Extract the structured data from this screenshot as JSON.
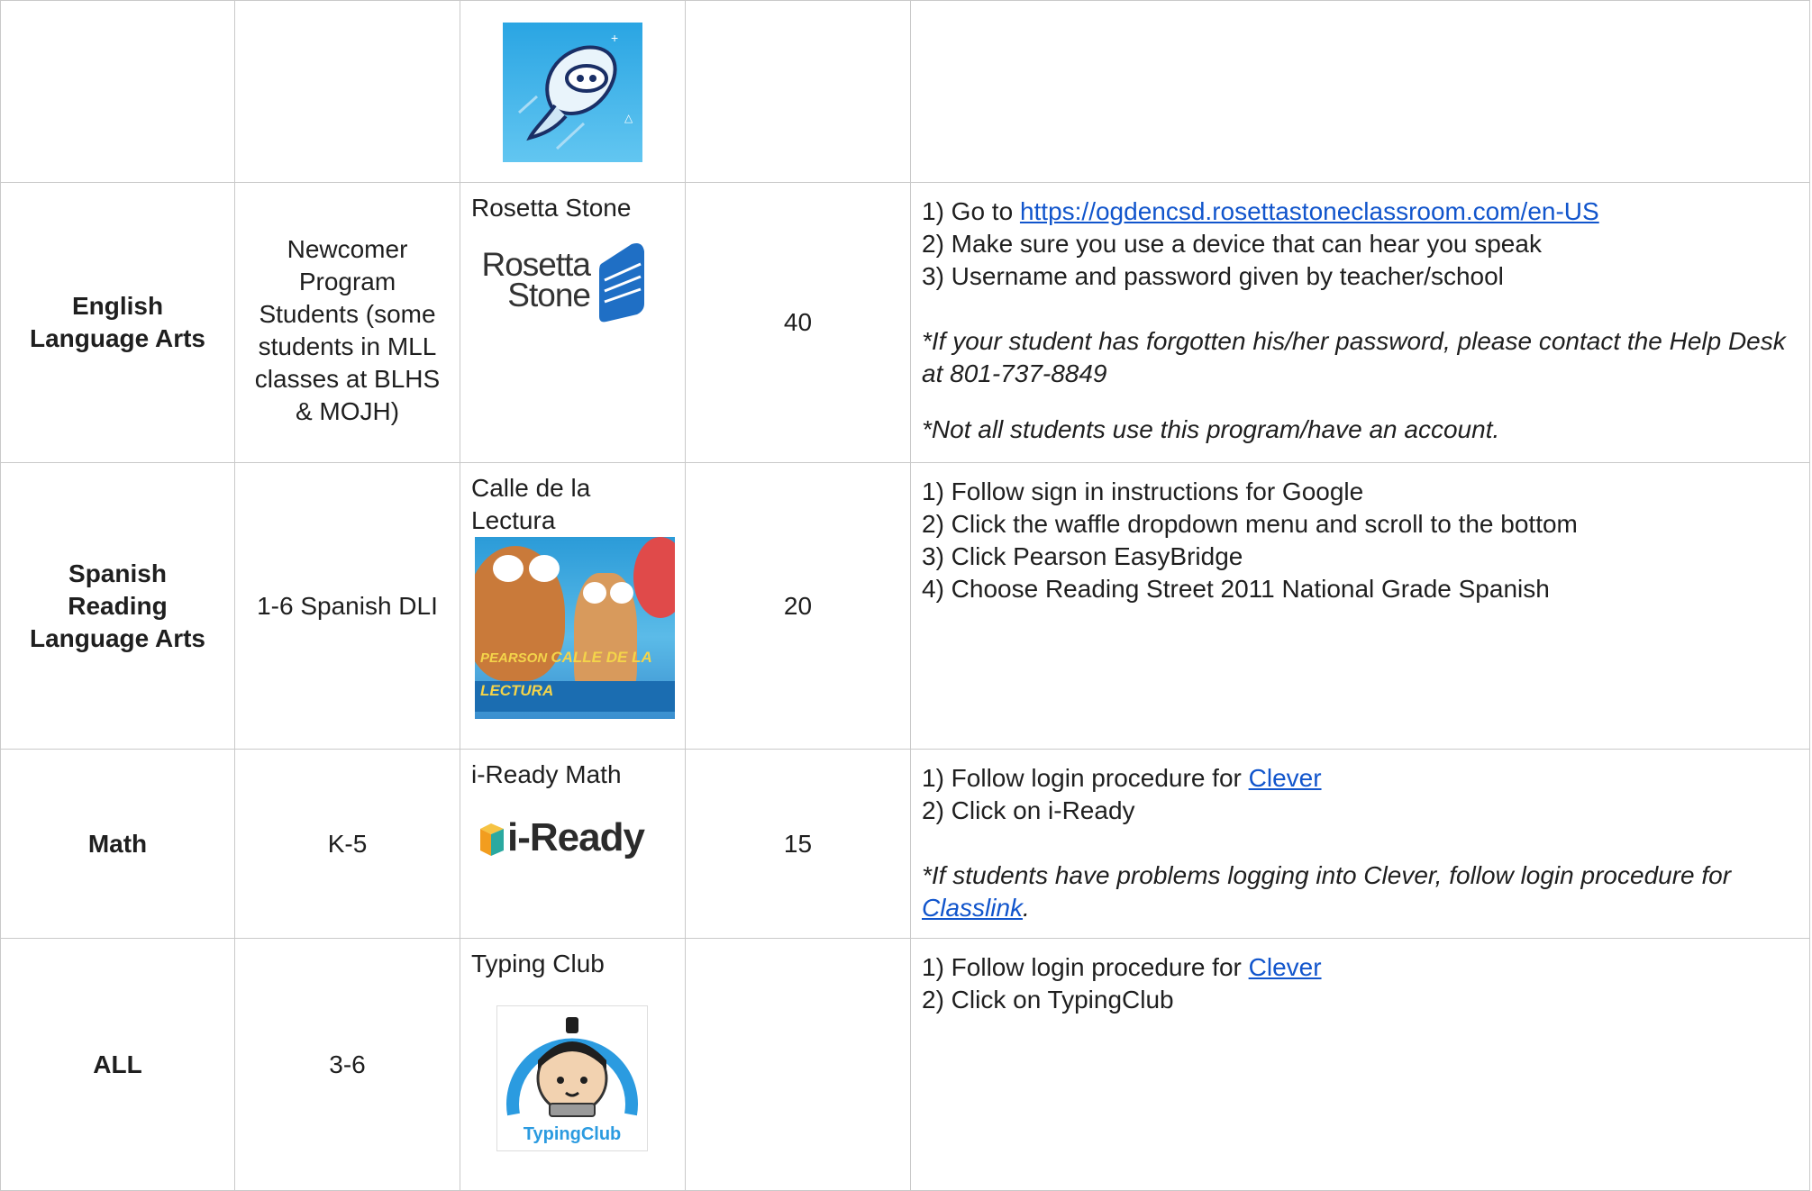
{
  "rows": [
    {
      "subject": "",
      "grades": "",
      "program": "",
      "logo_icon": "rocket-mascot-icon",
      "minutes": "",
      "instructions": []
    },
    {
      "subject_line1": "English",
      "subject_line2": "Language Arts",
      "grades_lines": [
        "Newcomer",
        "Program",
        "Students (some",
        "students in MLL",
        "classes at BLHS",
        "& MOJH)"
      ],
      "program": "Rosetta Stone",
      "logo_text_1": "Rosetta",
      "logo_text_2": "Stone",
      "logo_icon": "rosetta-stone-logo-icon",
      "minutes": "40",
      "step1_prefix": "1) Go to ",
      "step1_link": "https://ogdencsd.rosettastoneclassroom.com/en-US",
      "step2": "2) Make sure you use a device that can hear you speak",
      "step3": "3) Username and password given by teacher/school",
      "note1": "*If your student has forgotten his/her password, please contact the Help Desk at 801-737-8849",
      "note2": "*Not all students use this program/have an account."
    },
    {
      "subject_lines": [
        "Spanish",
        "Reading",
        "Language Arts"
      ],
      "grades": "1-6 Spanish DLI",
      "program_lines": [
        "Calle de la",
        "Lectura"
      ],
      "logo_text_1": "PEARSON",
      "logo_text_2": "CALLE DE LA LECTURA",
      "logo_icon": "calle-de-la-lectura-image-icon",
      "minutes": "20",
      "steps": [
        "1) Follow sign in instructions for Google",
        "2) Click the waffle dropdown menu and scroll to the bottom",
        "3) Click Pearson EasyBridge",
        "4) Choose Reading Street 2011 National Grade Spanish"
      ]
    },
    {
      "subject": "Math",
      "grades": "K-5",
      "program": "i-Ready Math",
      "logo_text": "i-Ready",
      "logo_icon": "i-ready-logo-icon",
      "minutes": "15",
      "step1_prefix": "1) Follow login procedure for ",
      "step1_link": "Clever",
      "step2": "2) Click on i-Ready",
      "note_prefix": "*If students have problems logging into Clever, follow login procedure for ",
      "note_link": "Classlink",
      "note_suffix": "."
    },
    {
      "subject": "ALL",
      "grades": "3-6",
      "program": "Typing Club",
      "logo_text": "TypingClub",
      "logo_icon": "typing-club-logo-icon",
      "minutes": "",
      "step1_prefix": "1) Follow login procedure for ",
      "step1_link": "Clever",
      "step2": "2) Click on TypingClub"
    }
  ],
  "colors": {
    "link": "#1155cc",
    "border": "#c9c9c9",
    "rosetta_blue": "#1f6fc5",
    "iready_orange": "#f29d1f"
  }
}
